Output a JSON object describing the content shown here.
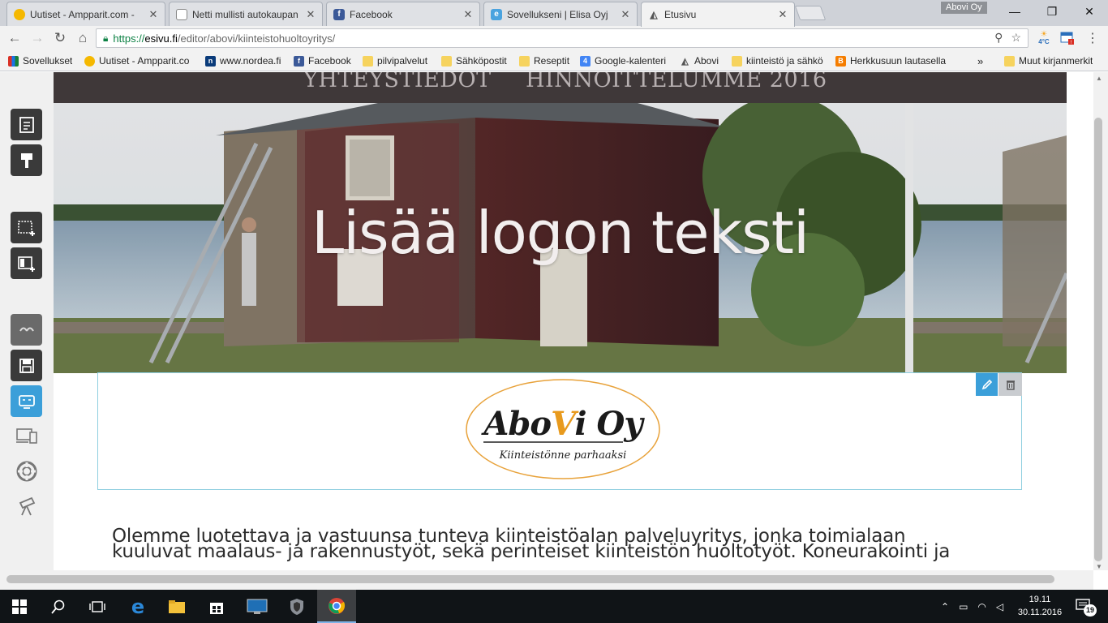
{
  "browser": {
    "tabs": [
      {
        "title": "Uutiset - Ampparit.com -",
        "icon": "ampparit-icon"
      },
      {
        "title": "Netti mullisti autokaupan",
        "icon": "page-icon"
      },
      {
        "title": "Facebook",
        "icon": "facebook-icon"
      },
      {
        "title": "Sovellukseni | Elisa Oyj",
        "icon": "elisa-icon"
      },
      {
        "title": "Etusivu",
        "icon": "esivu-icon"
      }
    ],
    "profile_name": "Abovi Oy",
    "address": {
      "scheme": "https://",
      "host": "esivu.fi",
      "path": "/editor/abovi/kiinteistohuoltoyritys/"
    },
    "weather_badge": "4°C",
    "bookmarks": [
      {
        "label": "Sovellukset"
      },
      {
        "label": "Uutiset - Ampparit.co"
      },
      {
        "label": "www.nordea.fi"
      },
      {
        "label": "Facebook"
      },
      {
        "label": "pilvipalvelut"
      },
      {
        "label": "Sähköpostit"
      },
      {
        "label": "Reseptit"
      },
      {
        "label": "Google-kalenteri"
      },
      {
        "label": "Abovi"
      },
      {
        "label": "kiinteistö ja sähkö"
      },
      {
        "label": "Herkkusuun lautasella"
      }
    ],
    "bookmarks_overflow": "»",
    "other_bookmarks": "Muut kirjanmerkit"
  },
  "site": {
    "nav": {
      "item1": "YHTEYSTIEDOT",
      "item2": "HINNOITTELUMME 2016"
    },
    "hero_title": "Lisää logon teksti",
    "logo": {
      "name_part1": "Abo",
      "name_v": "V",
      "name_part2": "i Oy",
      "tagline": "Kiinteistönne parhaaksi"
    },
    "body_line1": "Olemme luotettava ja vastuunsa tunteva kiinteistöalan palveluyritys, jonka toimialaan",
    "body_line2": "kuuluvat maalaus- ja rakennustyöt, sekä perinteiset kiinteistön huoltotyöt. Koneurakointi ja"
  },
  "taskbar": {
    "time": "19.11",
    "date": "30.11.2016",
    "notifications": "19"
  },
  "colors": {
    "nav_bg": "#3f3839",
    "accent_blue": "#3b9fd9",
    "logo_orange": "#e89a1d"
  }
}
